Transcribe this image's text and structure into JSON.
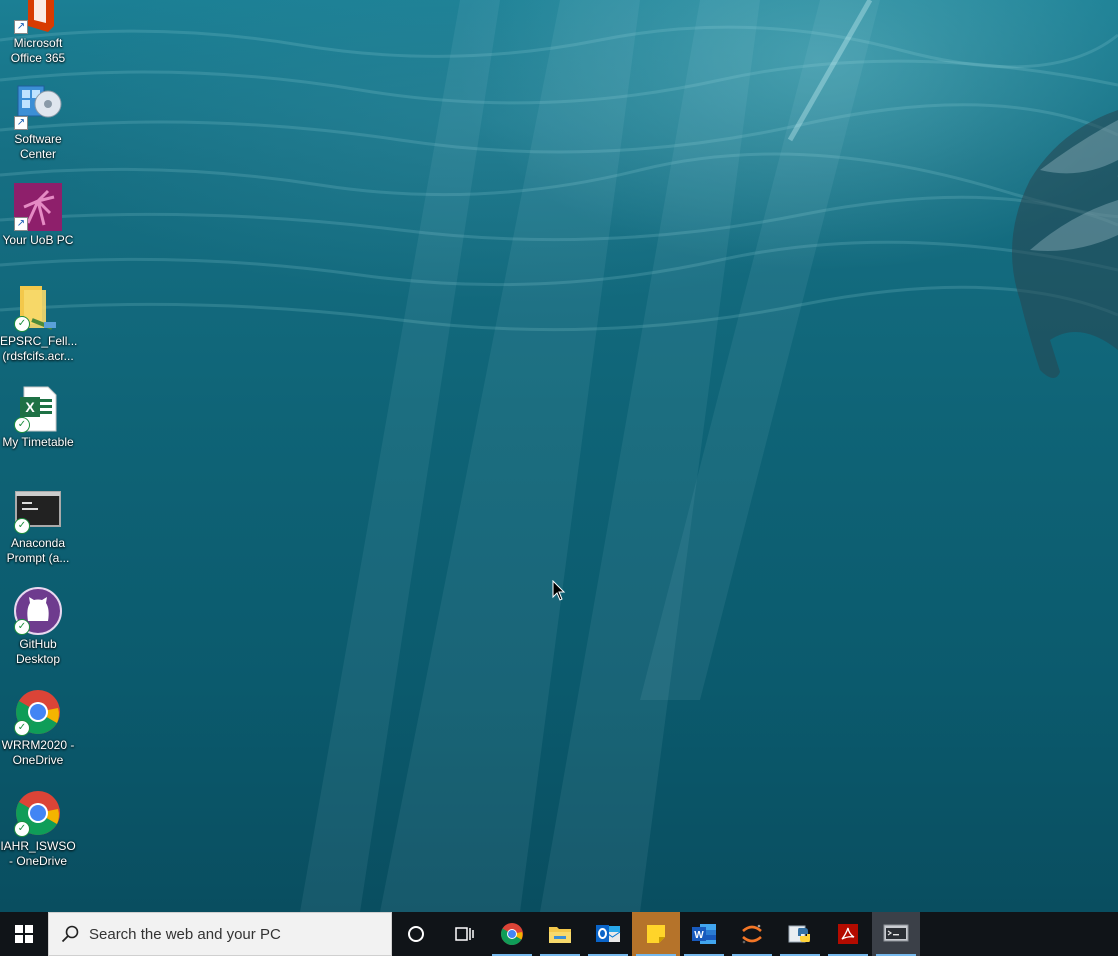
{
  "desktop": {
    "icons": [
      {
        "label": "Microsoft\nOffice 365",
        "icon": "office-icon",
        "badge": "shortcut"
      },
      {
        "label": "Software\nCenter",
        "icon": "software-center-icon",
        "badge": "shortcut"
      },
      {
        "label": "Your UoB PC",
        "icon": "uob-pc-icon",
        "badge": "shortcut"
      },
      {
        "label": "EPSRC_Fell...\n(rdsfcifs.acr...",
        "icon": "network-folder-icon",
        "badge": "synced"
      },
      {
        "label": "My Timetable",
        "icon": "excel-file-icon",
        "badge": "synced"
      },
      {
        "label": "Anaconda\nPrompt (a...",
        "icon": "terminal-icon",
        "badge": "synced"
      },
      {
        "label": "GitHub\nDesktop",
        "icon": "github-desktop-icon",
        "badge": "synced"
      },
      {
        "label": "WRRM2020 -\nOneDrive",
        "icon": "chrome-icon",
        "badge": "synced"
      },
      {
        "label": "IAHR_ISWSO\n- OneDrive",
        "icon": "chrome-icon",
        "badge": "synced"
      }
    ]
  },
  "taskbar": {
    "start_icon": "windows-logo-icon",
    "search_placeholder": "Search the web and your PC",
    "apps": [
      {
        "name": "cortana",
        "icon": "cortana-circle-icon"
      },
      {
        "name": "task-view",
        "icon": "task-view-icon"
      },
      {
        "name": "chrome",
        "icon": "chrome-icon",
        "state": "active"
      },
      {
        "name": "file-explorer",
        "icon": "folder-icon",
        "state": "active"
      },
      {
        "name": "outlook",
        "icon": "outlook-icon",
        "state": "active"
      },
      {
        "name": "sticky-notes",
        "icon": "sticky-notes-icon",
        "state": "highlight"
      },
      {
        "name": "word",
        "icon": "word-icon",
        "state": "active"
      },
      {
        "name": "jupyter",
        "icon": "jupyter-icon",
        "state": "active"
      },
      {
        "name": "python",
        "icon": "python-icon",
        "state": "active"
      },
      {
        "name": "acrobat",
        "icon": "acrobat-icon",
        "state": "active"
      },
      {
        "name": "terminal",
        "icon": "terminal-icon",
        "state": "pressed"
      }
    ]
  },
  "colors": {
    "water_top": "#1b7f94",
    "water_bottom": "#094e60",
    "taskbar": "#101418",
    "active_indicator": "#76b9ed"
  }
}
